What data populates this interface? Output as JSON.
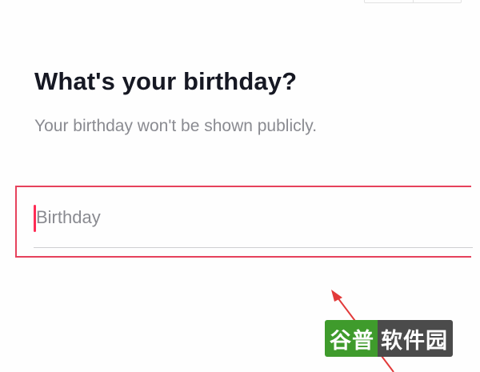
{
  "header": {
    "title": "What's your birthday?",
    "subtitle": "Your birthday won't be shown publicly."
  },
  "birthday_input": {
    "placeholder": "Birthday",
    "value": ""
  },
  "annotation": {
    "highlight_color": "#e6425c",
    "arrow_color": "#e23a3a"
  },
  "watermark": {
    "part1": "谷普",
    "part2": "软件园"
  },
  "colors": {
    "accent": "#fe2c55",
    "title": "#161823",
    "muted": "#8a8b91"
  }
}
